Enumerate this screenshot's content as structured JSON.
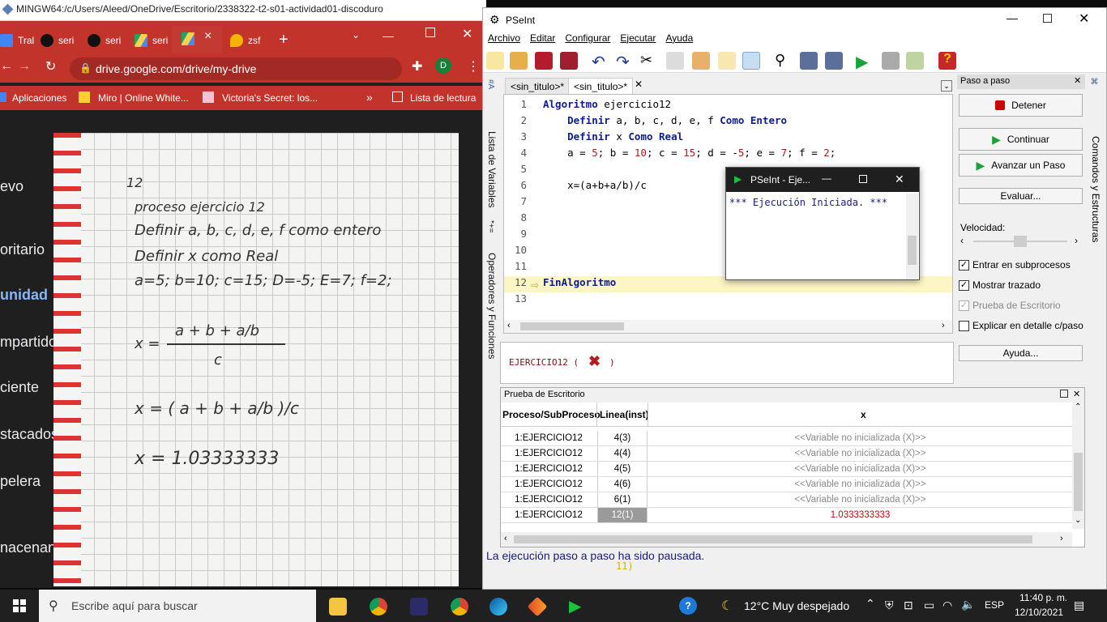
{
  "mingw": {
    "title": "MINGW64:/c/Users/Aleed/OneDrive/Escritorio/2338322-t2-s01-actividad01-discoduro"
  },
  "chrome": {
    "tabs": [
      {
        "label": "Tral",
        "color": "#4285f4"
      },
      {
        "label": "seri",
        "color": "#111111"
      },
      {
        "label": "seri",
        "color": "#111111"
      },
      {
        "label": "seri",
        "color": "#1fa463"
      },
      {
        "label": "zsf",
        "color": "#f4b400"
      }
    ],
    "active_tab_close": "×",
    "new_tab": "+",
    "url": "drive.google.com/drive/my-drive",
    "profile_letter": "D",
    "bookmarks": [
      {
        "label": "Aplicaciones"
      },
      {
        "label": "Miro | Online White..."
      },
      {
        "label": "Victoria's Secret: los..."
      }
    ],
    "bookmarks_more": "»",
    "reading_list": "Lista de lectura",
    "drive_sidebar": [
      "evo",
      "oritario",
      "unidad",
      "mpartido",
      "ciente",
      "stacados",
      "pelera",
      "nacenan"
    ]
  },
  "notebook": {
    "lines": [
      "12",
      "proceso ejercicio 12",
      "Definir a, b, c, d, e, f como entero",
      "Definir x como Real",
      "a=5; b=10; c=15; D=-5; E=7; f=2;",
      "x =",
      "a + b + a/b",
      "c",
      "x = ( a + b + a/b )/c",
      "x = 1.03333333"
    ]
  },
  "pseint": {
    "title": "PSeInt",
    "menu": [
      "Archivo",
      "Editar",
      "Configurar",
      "Ejecutar",
      "Ayuda"
    ],
    "left_tabs": [
      "Lista de Variables",
      "Operadores y Funciones"
    ],
    "right_tab": "Comandos y Estructuras",
    "editor_tabs": [
      "<sin_titulo>*",
      "<sin_titulo>*"
    ],
    "code": [
      {
        "n": "1",
        "parts": [
          {
            "k": "kw",
            "t": "Algoritmo "
          },
          {
            "k": "",
            "t": "ejercicio12"
          }
        ]
      },
      {
        "n": "2",
        "parts": [
          {
            "k": "",
            "t": "    "
          },
          {
            "k": "kw",
            "t": "Definir "
          },
          {
            "k": "",
            "t": "a, b, c, d, e, f "
          },
          {
            "k": "kw",
            "t": "Como Entero"
          }
        ]
      },
      {
        "n": "3",
        "parts": [
          {
            "k": "",
            "t": "    "
          },
          {
            "k": "kw",
            "t": "Definir "
          },
          {
            "k": "",
            "t": "x "
          },
          {
            "k": "kw",
            "t": "Como Real"
          }
        ]
      },
      {
        "n": "4",
        "parts": [
          {
            "k": "",
            "t": "    a = "
          },
          {
            "k": "num",
            "t": "5"
          },
          {
            "k": "",
            "t": "; b = "
          },
          {
            "k": "num",
            "t": "10"
          },
          {
            "k": "",
            "t": "; c = "
          },
          {
            "k": "num",
            "t": "15"
          },
          {
            "k": "",
            "t": "; d = -"
          },
          {
            "k": "num",
            "t": "5"
          },
          {
            "k": "",
            "t": "; e = "
          },
          {
            "k": "num",
            "t": "7"
          },
          {
            "k": "",
            "t": "; f = "
          },
          {
            "k": "num",
            "t": "2"
          },
          {
            "k": "",
            "t": ";"
          }
        ]
      },
      {
        "n": "5",
        "parts": []
      },
      {
        "n": "6",
        "parts": [
          {
            "k": "",
            "t": "    x=(a+b+a/b)/c"
          }
        ]
      },
      {
        "n": "7",
        "parts": []
      },
      {
        "n": "8",
        "parts": []
      },
      {
        "n": "9",
        "parts": []
      },
      {
        "n": "10",
        "parts": []
      },
      {
        "n": "11",
        "parts": []
      },
      {
        "n": "12",
        "parts": [
          {
            "k": "kw",
            "t": "FinAlgoritmo"
          }
        ]
      },
      {
        "n": "13",
        "parts": []
      }
    ],
    "status_expr": "EJERCICIO12 (",
    "status_close": ")",
    "paso": {
      "title": "Paso a paso",
      "detener": "Detener",
      "continuar": "Continuar",
      "avanzar": "Avanzar un Paso",
      "evaluar": "Evaluar...",
      "velocidad": "Velocidad:",
      "speed_fraction": 0.5,
      "checks": [
        {
          "label": "Entrar en subprocesos",
          "checked": "✓"
        },
        {
          "label": "Mostrar trazado",
          "checked": "✓"
        },
        {
          "label": "Prueba de Escritorio",
          "checked": "✓"
        },
        {
          "label": "Explicar en detalle c/paso",
          "checked": ""
        }
      ],
      "ayuda": "Ayuda..."
    },
    "prueba": {
      "title": "Prueba de Escritorio",
      "headers": [
        "Proceso/SubProceso",
        "Linea(inst)",
        "x"
      ],
      "rows": [
        [
          "1:EJERCICIO12",
          "4(3)",
          "<<Variable no inicializada (X)>>"
        ],
        [
          "1:EJERCICIO12",
          "4(4)",
          "<<Variable no inicializada (X)>>"
        ],
        [
          "1:EJERCICIO12",
          "4(5)",
          "<<Variable no inicializada (X)>>"
        ],
        [
          "1:EJERCICIO12",
          "4(6)",
          "<<Variable no inicializada (X)>>"
        ],
        [
          "1:EJERCICIO12",
          "6(1)",
          "<<Variable no inicializada (X)>>"
        ],
        [
          "1:EJERCICIO12",
          "12(1)",
          "1.0333333333"
        ]
      ]
    },
    "status": "La ejecución paso a paso ha sido pausada.",
    "console_fragment": "11)"
  },
  "popup": {
    "title": "PSeInt - Eje...",
    "text": "*** Ejecución Iniciada. ***"
  },
  "taskbar": {
    "search": "Escribe aquí para buscar",
    "weather": "12°C  Muy despejado",
    "lang": "ESP",
    "time": "11:40 p. m.",
    "date": "12/10/2021"
  }
}
